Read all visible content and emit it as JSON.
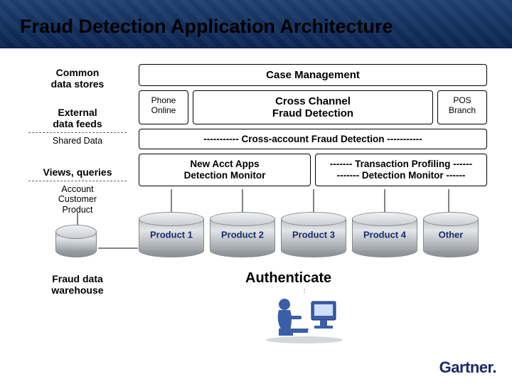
{
  "title": "Fraud Detection Application Architecture",
  "left": {
    "common": "Common\ndata stores",
    "external": "External\ndata feeds",
    "shared": "Shared Data",
    "views": "Views, queries",
    "acp": "Account\nCustomer\nProduct",
    "fdw": "Fraud data\nwarehouse"
  },
  "main": {
    "case_mgmt": "Case Management",
    "phone_online": "Phone\nOnline",
    "cross_channel": "Cross Channel\nFraud Detection",
    "pos_branch": "POS\nBranch",
    "cross_account": "----------- Cross-account Fraud Detection -----------",
    "new_acct": "New Acct Apps\nDetection Monitor",
    "txn_profiling": "------- Transaction Profiling ------\n------- Detection Monitor  ------"
  },
  "cylinders": {
    "p1": "Product 1",
    "p2": "Product 2",
    "p3": "Product 3",
    "p4": "Product 4",
    "other": "Other"
  },
  "authenticate": "Authenticate",
  "logo": "Gartner"
}
